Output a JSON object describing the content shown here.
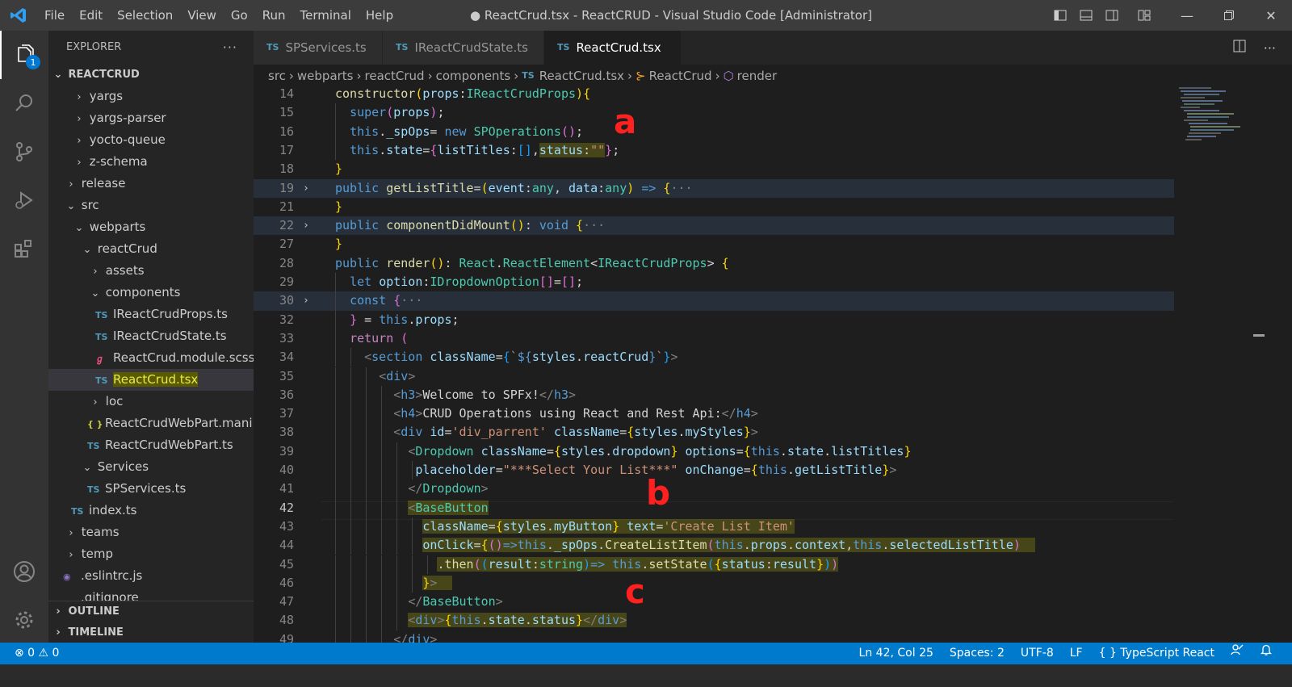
{
  "menu": [
    "File",
    "Edit",
    "Selection",
    "View",
    "Go",
    "Run",
    "Terminal",
    "Help"
  ],
  "window_title": "● ReactCrud.tsx - ReactCRUD - Visual Studio Code [Administrator]",
  "activity": {
    "explorer_badge": "1"
  },
  "sidebar": {
    "header": "EXPLORER",
    "more": "···",
    "project": "REACTCRUD",
    "items": [
      {
        "label": "yargs",
        "chev": "›"
      },
      {
        "label": "yargs-parser",
        "chev": "›"
      },
      {
        "label": "yocto-queue",
        "chev": "›"
      },
      {
        "label": "z-schema",
        "chev": "›"
      },
      {
        "label": "release",
        "chev": "›"
      },
      {
        "label": "src",
        "chev": "⌄"
      },
      {
        "label": "webparts",
        "chev": "⌄"
      },
      {
        "label": "reactCrud",
        "chev": "⌄"
      },
      {
        "label": "assets",
        "chev": "›"
      },
      {
        "label": "components",
        "chev": "⌄"
      },
      {
        "label": "IReactCrudProps.ts",
        "icon": "TS"
      },
      {
        "label": "IReactCrudState.ts",
        "icon": "TS"
      },
      {
        "label": "ReactCrud.module.scss",
        "icon": "ℊ"
      },
      {
        "label": "ReactCrud.tsx",
        "icon": "TS"
      },
      {
        "label": "loc",
        "chev": "›"
      },
      {
        "label": "ReactCrudWebPart.mani...",
        "icon": "{ }"
      },
      {
        "label": "ReactCrudWebPart.ts",
        "icon": "TS"
      },
      {
        "label": "Services",
        "chev": "⌄"
      },
      {
        "label": "SPServices.ts",
        "icon": "TS"
      },
      {
        "label": "index.ts",
        "icon": "TS"
      },
      {
        "label": "teams",
        "chev": "›"
      },
      {
        "label": "temp",
        "chev": "›"
      },
      {
        "label": ".eslintrc.js",
        "icon": "◉"
      },
      {
        "label": ".gitignore",
        "icon": ""
      }
    ],
    "outline": "OUTLINE",
    "timeline": "TIMELINE"
  },
  "tabs": [
    {
      "icon": "TS",
      "label": "SPServices.ts"
    },
    {
      "icon": "TS",
      "label": "IReactCrudState.ts"
    },
    {
      "icon": "TS",
      "label": "ReactCrud.tsx"
    }
  ],
  "breadcrumb": [
    "src",
    "webparts",
    "reactCrud",
    "components",
    "ReactCrud.tsx",
    "ReactCrud",
    "render"
  ],
  "breadcrumb_icons": {
    "file": "TS",
    "class": "⊱",
    "method": "⬡"
  },
  "line_numbers": [
    "14",
    "15",
    "16",
    "17",
    "18",
    "19",
    "21",
    "22",
    "27",
    "28",
    "29",
    "30",
    "32",
    "33",
    "34",
    "35",
    "36",
    "37",
    "38",
    "39",
    "40",
    "41",
    "42",
    "43",
    "44",
    "45",
    "46",
    "47",
    "48",
    "49"
  ],
  "annotations": [
    "a",
    "b",
    "c"
  ],
  "status": {
    "problems": "⊗ 0 ⚠ 0",
    "position": "Ln 42, Col 25",
    "spaces": "Spaces: 2",
    "encoding": "UTF-8",
    "eol": "LF",
    "language": "{ }  TypeScript React"
  }
}
